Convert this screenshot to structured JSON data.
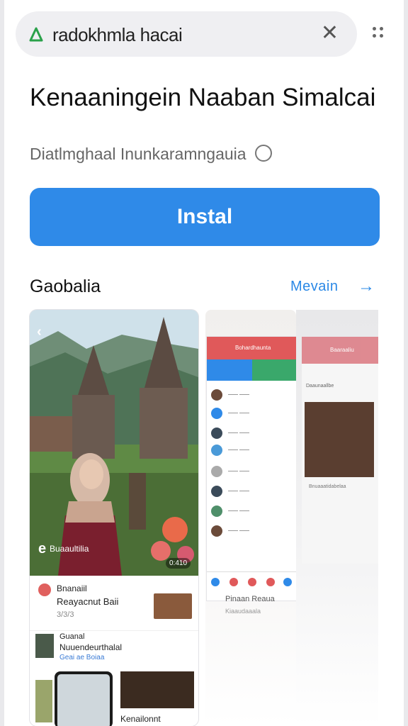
{
  "browser": {
    "url": "radokhmla hacai",
    "close_icon": "close-icon",
    "menu_icon": "more-icon"
  },
  "app": {
    "title": "Kenaaningein Naaban Simalcai",
    "subtitle": "Diatlmghaal Inunkaramngauia",
    "install_label": "Instal"
  },
  "gallery": {
    "label": "Gaobalia",
    "more_label": "Mevain",
    "more_arrow": "->",
    "card1": {
      "caption": "Buaaultilia",
      "badge": "0:410",
      "row1_title": "Bnanaiil",
      "row1_text": "Reayacnut Baii",
      "row1_meta": "3/3/3",
      "row2_title": "Guanal",
      "row2_text": "Nuuendeurthalal",
      "row2_meta": "Geai ae Boiaa",
      "row3_label": "Kenailonnt"
    },
    "card2": {
      "header": "Bohardhaunta",
      "footer_title": "Pinaan Reaua",
      "footer_meta": "Kiaaudaaala"
    },
    "card3": {
      "header": "Baaraaliu",
      "row": "Daaunaallbe",
      "caption": "Bnuaaatidabelaa"
    }
  },
  "colors": {
    "accent": "#2f8ae8",
    "red": "#e0595a",
    "green": "#3aa86b"
  }
}
